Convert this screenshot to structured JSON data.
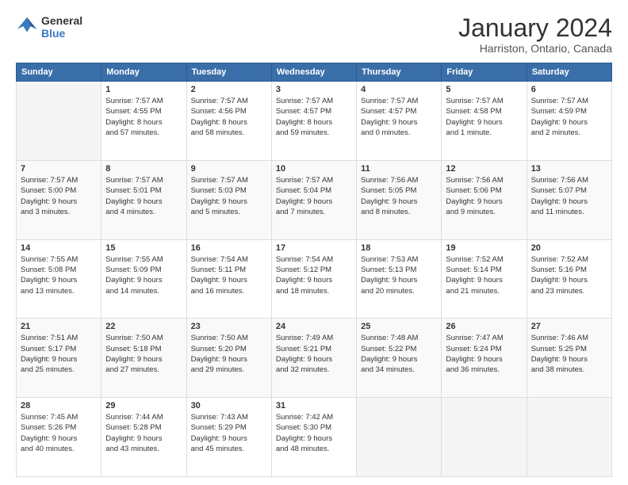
{
  "logo": {
    "line1": "General",
    "line2": "Blue"
  },
  "title": "January 2024",
  "subtitle": "Harriston, Ontario, Canada",
  "weekdays": [
    "Sunday",
    "Monday",
    "Tuesday",
    "Wednesday",
    "Thursday",
    "Friday",
    "Saturday"
  ],
  "weeks": [
    [
      {
        "day": "",
        "info": ""
      },
      {
        "day": "1",
        "info": "Sunrise: 7:57 AM\nSunset: 4:55 PM\nDaylight: 8 hours\nand 57 minutes."
      },
      {
        "day": "2",
        "info": "Sunrise: 7:57 AM\nSunset: 4:56 PM\nDaylight: 8 hours\nand 58 minutes."
      },
      {
        "day": "3",
        "info": "Sunrise: 7:57 AM\nSunset: 4:57 PM\nDaylight: 8 hours\nand 59 minutes."
      },
      {
        "day": "4",
        "info": "Sunrise: 7:57 AM\nSunset: 4:57 PM\nDaylight: 9 hours\nand 0 minutes."
      },
      {
        "day": "5",
        "info": "Sunrise: 7:57 AM\nSunset: 4:58 PM\nDaylight: 9 hours\nand 1 minute."
      },
      {
        "day": "6",
        "info": "Sunrise: 7:57 AM\nSunset: 4:59 PM\nDaylight: 9 hours\nand 2 minutes."
      }
    ],
    [
      {
        "day": "7",
        "info": "Sunrise: 7:57 AM\nSunset: 5:00 PM\nDaylight: 9 hours\nand 3 minutes."
      },
      {
        "day": "8",
        "info": "Sunrise: 7:57 AM\nSunset: 5:01 PM\nDaylight: 9 hours\nand 4 minutes."
      },
      {
        "day": "9",
        "info": "Sunrise: 7:57 AM\nSunset: 5:03 PM\nDaylight: 9 hours\nand 5 minutes."
      },
      {
        "day": "10",
        "info": "Sunrise: 7:57 AM\nSunset: 5:04 PM\nDaylight: 9 hours\nand 7 minutes."
      },
      {
        "day": "11",
        "info": "Sunrise: 7:56 AM\nSunset: 5:05 PM\nDaylight: 9 hours\nand 8 minutes."
      },
      {
        "day": "12",
        "info": "Sunrise: 7:56 AM\nSunset: 5:06 PM\nDaylight: 9 hours\nand 9 minutes."
      },
      {
        "day": "13",
        "info": "Sunrise: 7:56 AM\nSunset: 5:07 PM\nDaylight: 9 hours\nand 11 minutes."
      }
    ],
    [
      {
        "day": "14",
        "info": "Sunrise: 7:55 AM\nSunset: 5:08 PM\nDaylight: 9 hours\nand 13 minutes."
      },
      {
        "day": "15",
        "info": "Sunrise: 7:55 AM\nSunset: 5:09 PM\nDaylight: 9 hours\nand 14 minutes."
      },
      {
        "day": "16",
        "info": "Sunrise: 7:54 AM\nSunset: 5:11 PM\nDaylight: 9 hours\nand 16 minutes."
      },
      {
        "day": "17",
        "info": "Sunrise: 7:54 AM\nSunset: 5:12 PM\nDaylight: 9 hours\nand 18 minutes."
      },
      {
        "day": "18",
        "info": "Sunrise: 7:53 AM\nSunset: 5:13 PM\nDaylight: 9 hours\nand 20 minutes."
      },
      {
        "day": "19",
        "info": "Sunrise: 7:52 AM\nSunset: 5:14 PM\nDaylight: 9 hours\nand 21 minutes."
      },
      {
        "day": "20",
        "info": "Sunrise: 7:52 AM\nSunset: 5:16 PM\nDaylight: 9 hours\nand 23 minutes."
      }
    ],
    [
      {
        "day": "21",
        "info": "Sunrise: 7:51 AM\nSunset: 5:17 PM\nDaylight: 9 hours\nand 25 minutes."
      },
      {
        "day": "22",
        "info": "Sunrise: 7:50 AM\nSunset: 5:18 PM\nDaylight: 9 hours\nand 27 minutes."
      },
      {
        "day": "23",
        "info": "Sunrise: 7:50 AM\nSunset: 5:20 PM\nDaylight: 9 hours\nand 29 minutes."
      },
      {
        "day": "24",
        "info": "Sunrise: 7:49 AM\nSunset: 5:21 PM\nDaylight: 9 hours\nand 32 minutes."
      },
      {
        "day": "25",
        "info": "Sunrise: 7:48 AM\nSunset: 5:22 PM\nDaylight: 9 hours\nand 34 minutes."
      },
      {
        "day": "26",
        "info": "Sunrise: 7:47 AM\nSunset: 5:24 PM\nDaylight: 9 hours\nand 36 minutes."
      },
      {
        "day": "27",
        "info": "Sunrise: 7:46 AM\nSunset: 5:25 PM\nDaylight: 9 hours\nand 38 minutes."
      }
    ],
    [
      {
        "day": "28",
        "info": "Sunrise: 7:45 AM\nSunset: 5:26 PM\nDaylight: 9 hours\nand 40 minutes."
      },
      {
        "day": "29",
        "info": "Sunrise: 7:44 AM\nSunset: 5:28 PM\nDaylight: 9 hours\nand 43 minutes."
      },
      {
        "day": "30",
        "info": "Sunrise: 7:43 AM\nSunset: 5:29 PM\nDaylight: 9 hours\nand 45 minutes."
      },
      {
        "day": "31",
        "info": "Sunrise: 7:42 AM\nSunset: 5:30 PM\nDaylight: 9 hours\nand 48 minutes."
      },
      {
        "day": "",
        "info": ""
      },
      {
        "day": "",
        "info": ""
      },
      {
        "day": "",
        "info": ""
      }
    ]
  ]
}
